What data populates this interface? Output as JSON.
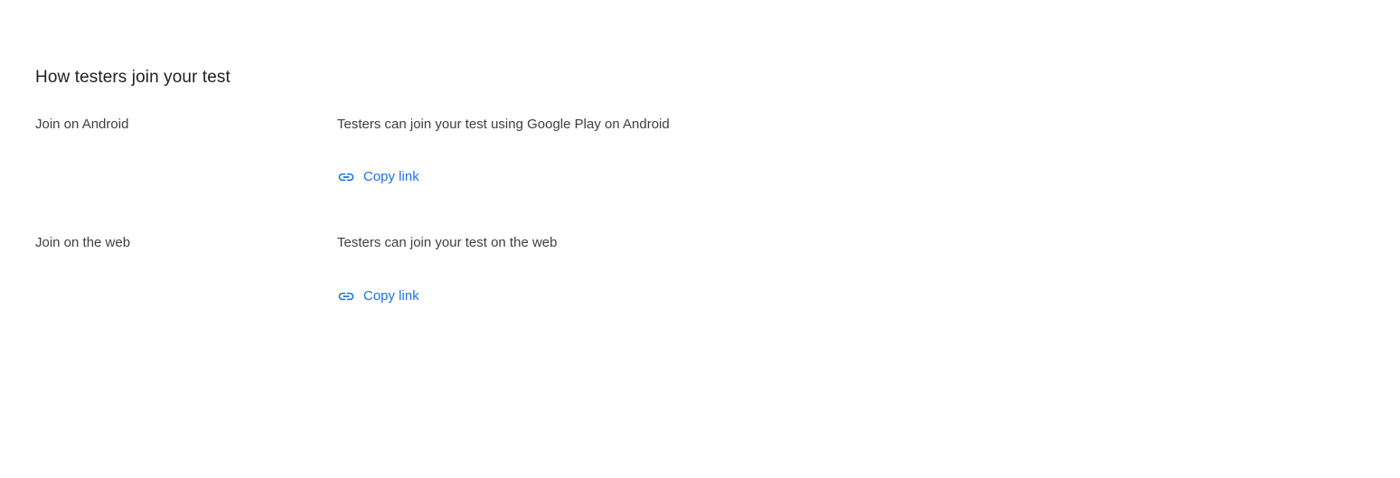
{
  "section": {
    "title": "How testers join your test"
  },
  "rows": [
    {
      "label": "Join on Android",
      "description": "Testers can join your test using Google Play on Android",
      "action_label": "Copy link",
      "action_icon": "link-icon"
    },
    {
      "label": "Join on the web",
      "description": "Testers can join your test on the web",
      "action_label": "Copy link",
      "action_icon": "link-icon"
    }
  ],
  "colors": {
    "link": "#1a73e8",
    "text": "#3c4043",
    "title": "#202124"
  }
}
